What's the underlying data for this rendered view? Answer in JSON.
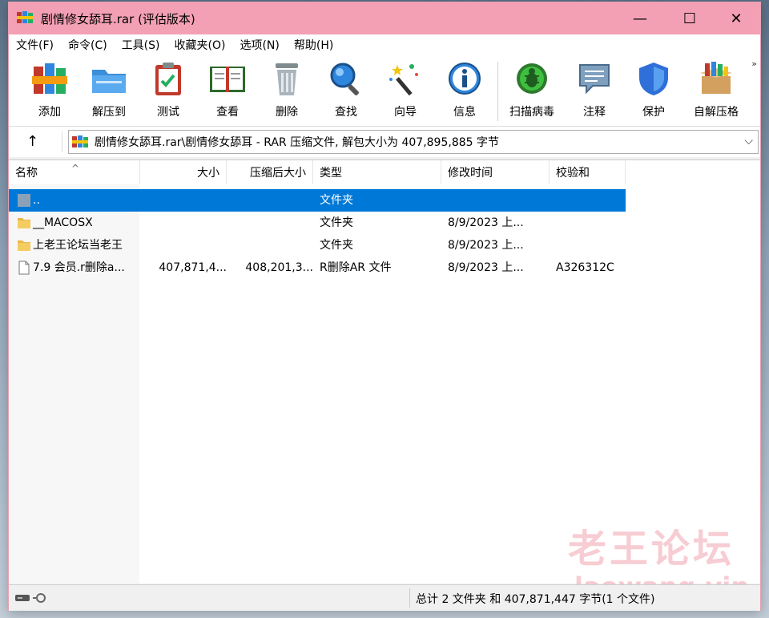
{
  "window": {
    "title": "剧情修女舔耳.rar (评估版本)",
    "controls": {
      "minimize": "—",
      "maximize": "☐",
      "close": "✕"
    }
  },
  "menu": [
    {
      "label": "文件(F)"
    },
    {
      "label": "命令(C)"
    },
    {
      "label": "工具(S)"
    },
    {
      "label": "收藏夹(O)"
    },
    {
      "label": "选项(N)"
    },
    {
      "label": "帮助(H)"
    }
  ],
  "toolbar": {
    "more": "»",
    "items": [
      {
        "label": "添加",
        "icon": "books-add-icon"
      },
      {
        "label": "解压到",
        "icon": "folder-extract-icon"
      },
      {
        "label": "测试",
        "icon": "clipboard-test-icon"
      },
      {
        "label": "查看",
        "icon": "book-view-icon"
      },
      {
        "label": "删除",
        "icon": "trash-icon"
      },
      {
        "label": "查找",
        "icon": "magnifier-icon"
      },
      {
        "label": "向导",
        "icon": "wand-icon"
      },
      {
        "label": "信息",
        "icon": "info-icon"
      },
      {
        "label": "扫描病毒",
        "icon": "bug-scan-icon"
      },
      {
        "label": "注释",
        "icon": "comment-icon"
      },
      {
        "label": "保护",
        "icon": "shield-icon"
      },
      {
        "label": "自解压格",
        "icon": "sfx-box-icon"
      }
    ]
  },
  "address": {
    "up": "↑",
    "path": "剧情修女舔耳.rar\\剧情修女舔耳 - RAR 压缩文件, 解包大小为 407,895,885 字节",
    "dropdown": "⌵"
  },
  "columns": {
    "name": "名称",
    "size": "大小",
    "packed": "压缩后大小",
    "type": "类型",
    "modified": "修改时间",
    "crc": "校验和",
    "sort_indicator": "^"
  },
  "files": [
    {
      "name": "..",
      "size": "",
      "packed": "",
      "type": "文件夹",
      "modified": "",
      "crc": "",
      "icon": "parent-folder-icon",
      "selected": true
    },
    {
      "name": "__MACOSX",
      "size": "",
      "packed": "",
      "type": "文件夹",
      "modified": "8/9/2023 上...",
      "crc": "",
      "icon": "folder-icon",
      "selected": false
    },
    {
      "name": "上老王论坛当老王",
      "size": "",
      "packed": "",
      "type": "文件夹",
      "modified": "8/9/2023 上...",
      "crc": "",
      "icon": "folder-icon",
      "selected": false
    },
    {
      "name": "7.9 会员.r删除a...",
      "size": "407,871,4...",
      "packed": "408,201,3...",
      "type": "R删除AR 文件",
      "modified": "8/9/2023 上...",
      "crc": "A326312C",
      "icon": "file-icon",
      "selected": false
    }
  ],
  "status": {
    "summary": "总计 2 文件夹 和 407,871,447 字节(1 个文件)"
  },
  "watermark": {
    "text": "老王论坛",
    "url": "laowang.vip"
  }
}
